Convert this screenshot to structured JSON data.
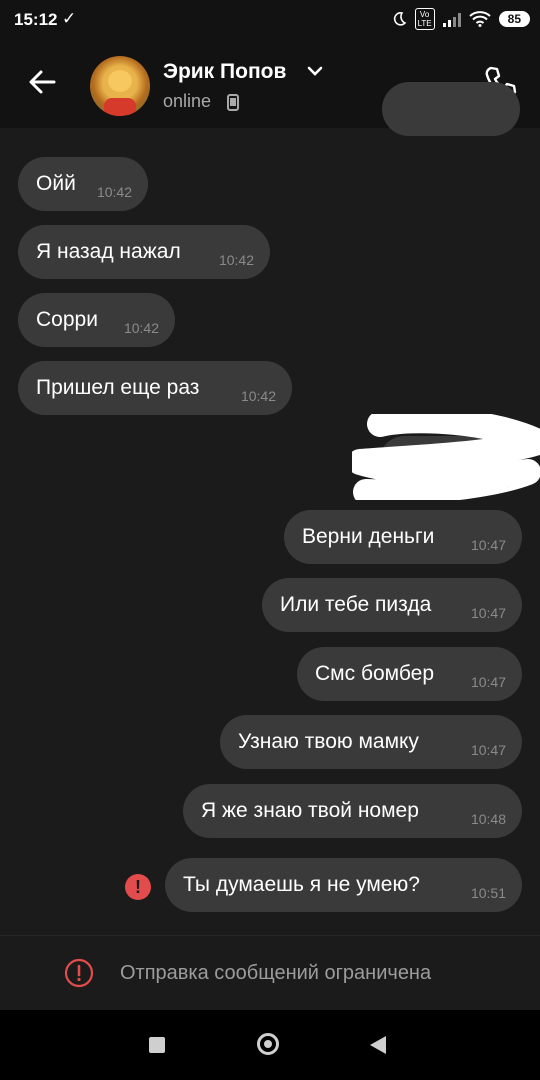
{
  "status_bar": {
    "time": "15:12",
    "check": "✓",
    "volte_top": "Vo",
    "volte_bottom": "LTE",
    "battery": "85"
  },
  "header": {
    "contact_name": "Эрик Попов",
    "status": "online",
    "icons": [
      "back-arrow-icon",
      "chevron-down-icon",
      "mobile-phone-icon",
      "phone-icon"
    ]
  },
  "messages": [
    {
      "text": "Ойй",
      "time": "10:42",
      "direction": "incoming"
    },
    {
      "text": "Я назад нажал",
      "time": "10:42",
      "direction": "incoming"
    },
    {
      "text": "Сорри",
      "time": "10:42",
      "direction": "incoming"
    },
    {
      "text": "Пришел еще раз",
      "time": "10:42",
      "direction": "incoming"
    },
    {
      "text": "Верни деньги",
      "time": "10:47",
      "direction": "outgoing"
    },
    {
      "text": "Или тебе пизда",
      "time": "10:47",
      "direction": "outgoing"
    },
    {
      "text": "Смс бомбер",
      "time": "10:47",
      "direction": "outgoing"
    },
    {
      "text": "Узнаю твою мамку",
      "time": "10:47",
      "direction": "outgoing"
    },
    {
      "text": "Я же знаю твой номер",
      "time": "10:48",
      "direction": "outgoing"
    },
    {
      "text": "Ты думаешь я не умею?",
      "time": "10:51",
      "direction": "outgoing",
      "failed": true
    }
  ],
  "error_icon": "!",
  "restriction": {
    "text": "Отправка сообщений ограничена",
    "icon": "alert-circle-icon"
  },
  "colors": {
    "bubble": "#3a3a3a",
    "background": "#1b1b1b",
    "error": "#e24c4c"
  }
}
